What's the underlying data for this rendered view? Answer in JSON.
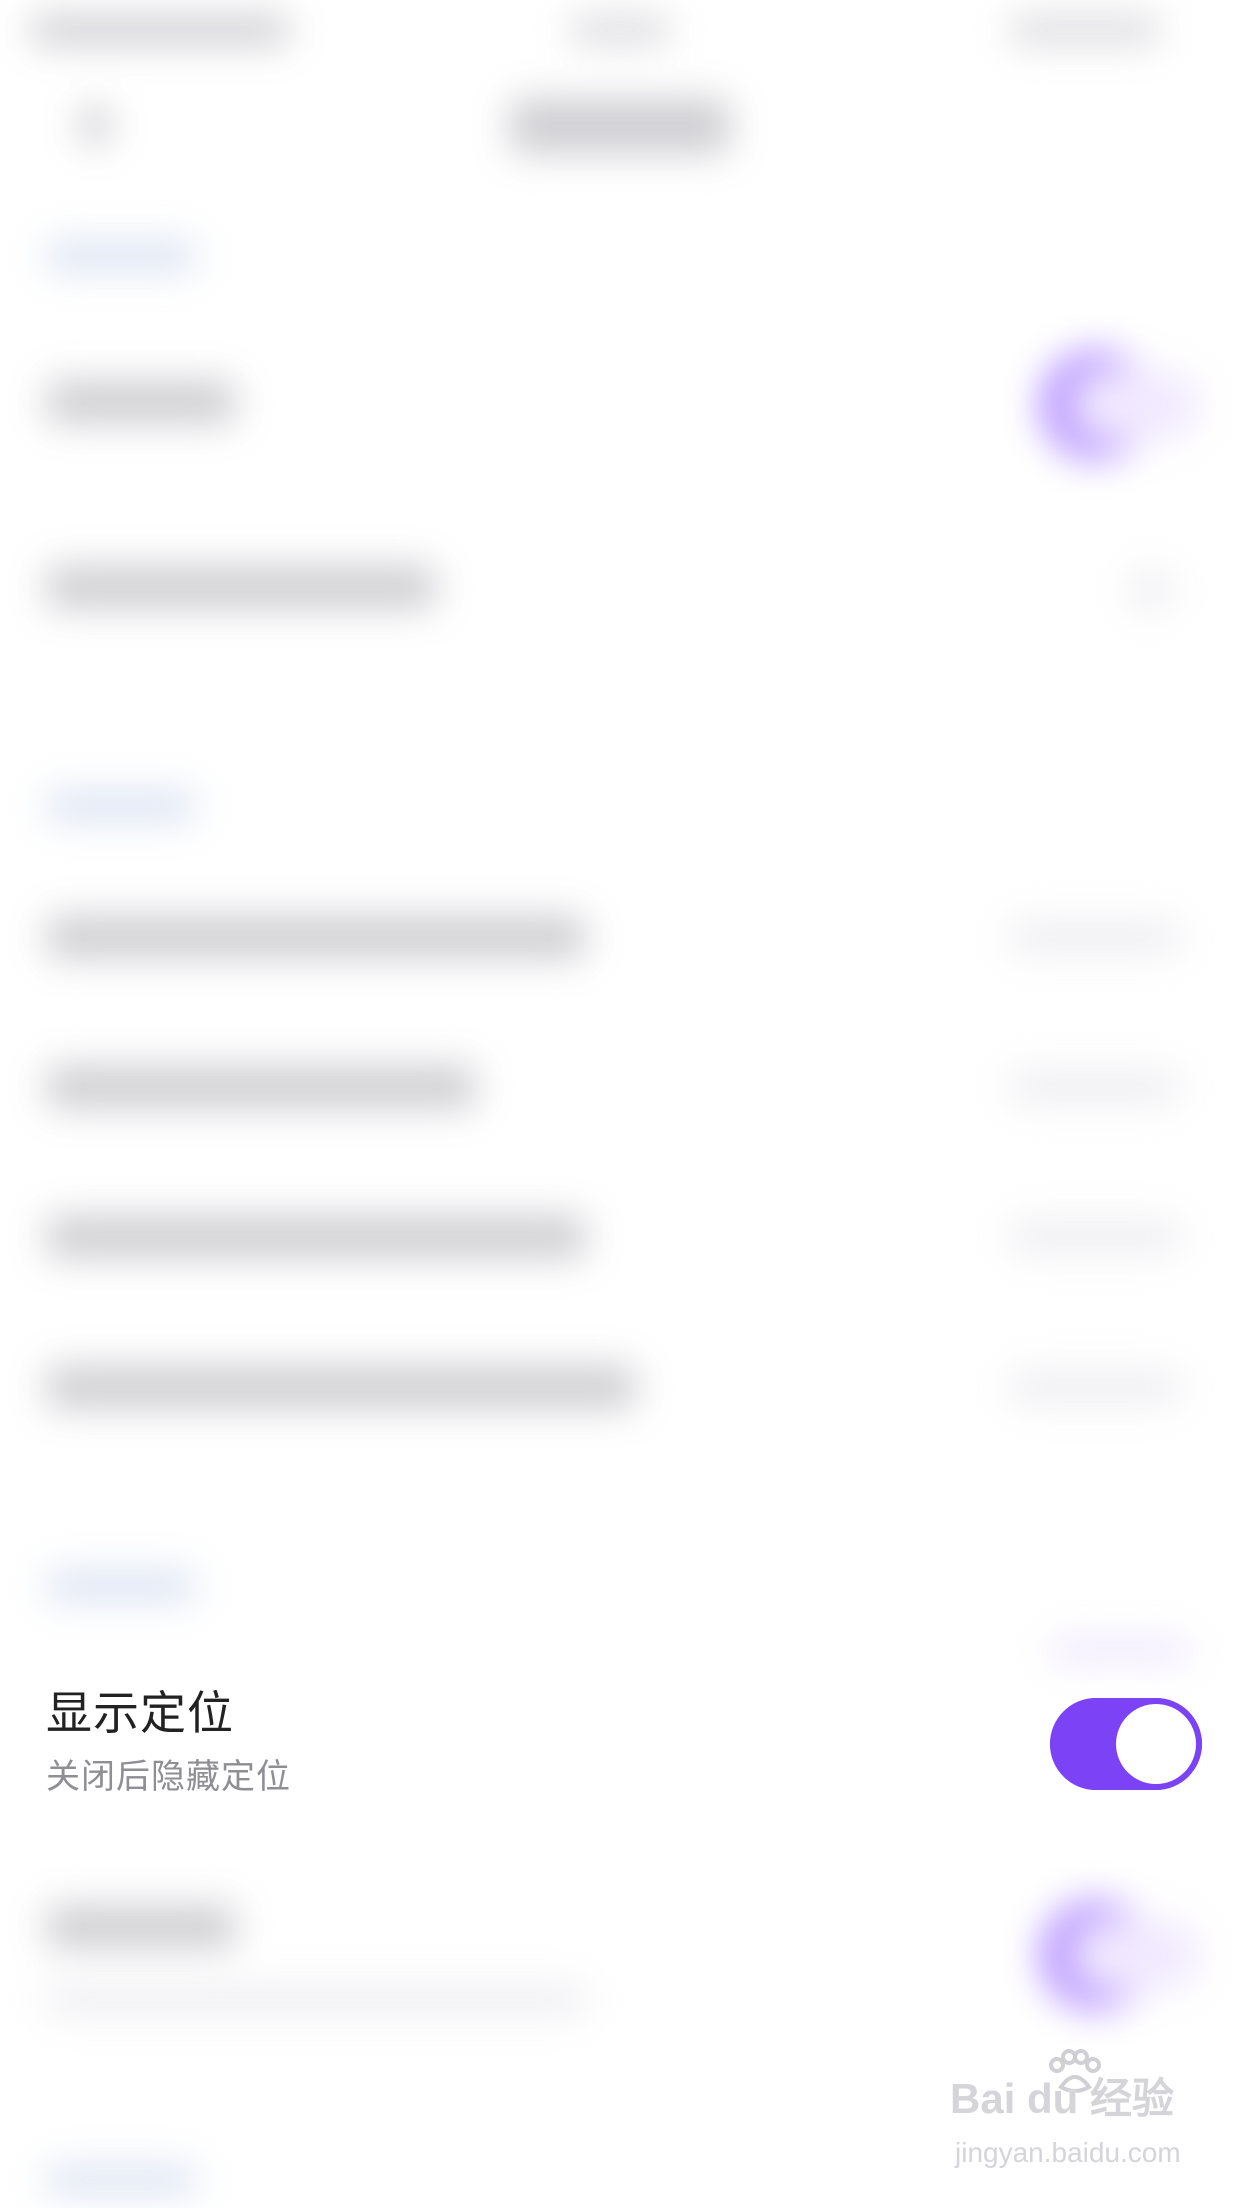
{
  "setting": {
    "title": "显示定位",
    "subtitle": "关闭后隐藏定位",
    "toggle_state": "on"
  },
  "colors": {
    "accent": "#7b43f5",
    "title_text": "#222222",
    "subtitle_text": "#8e8e93",
    "background": "#ffffff"
  },
  "watermark": {
    "brand": "Bai du 经验",
    "url": "jingyan.baidu.com"
  }
}
